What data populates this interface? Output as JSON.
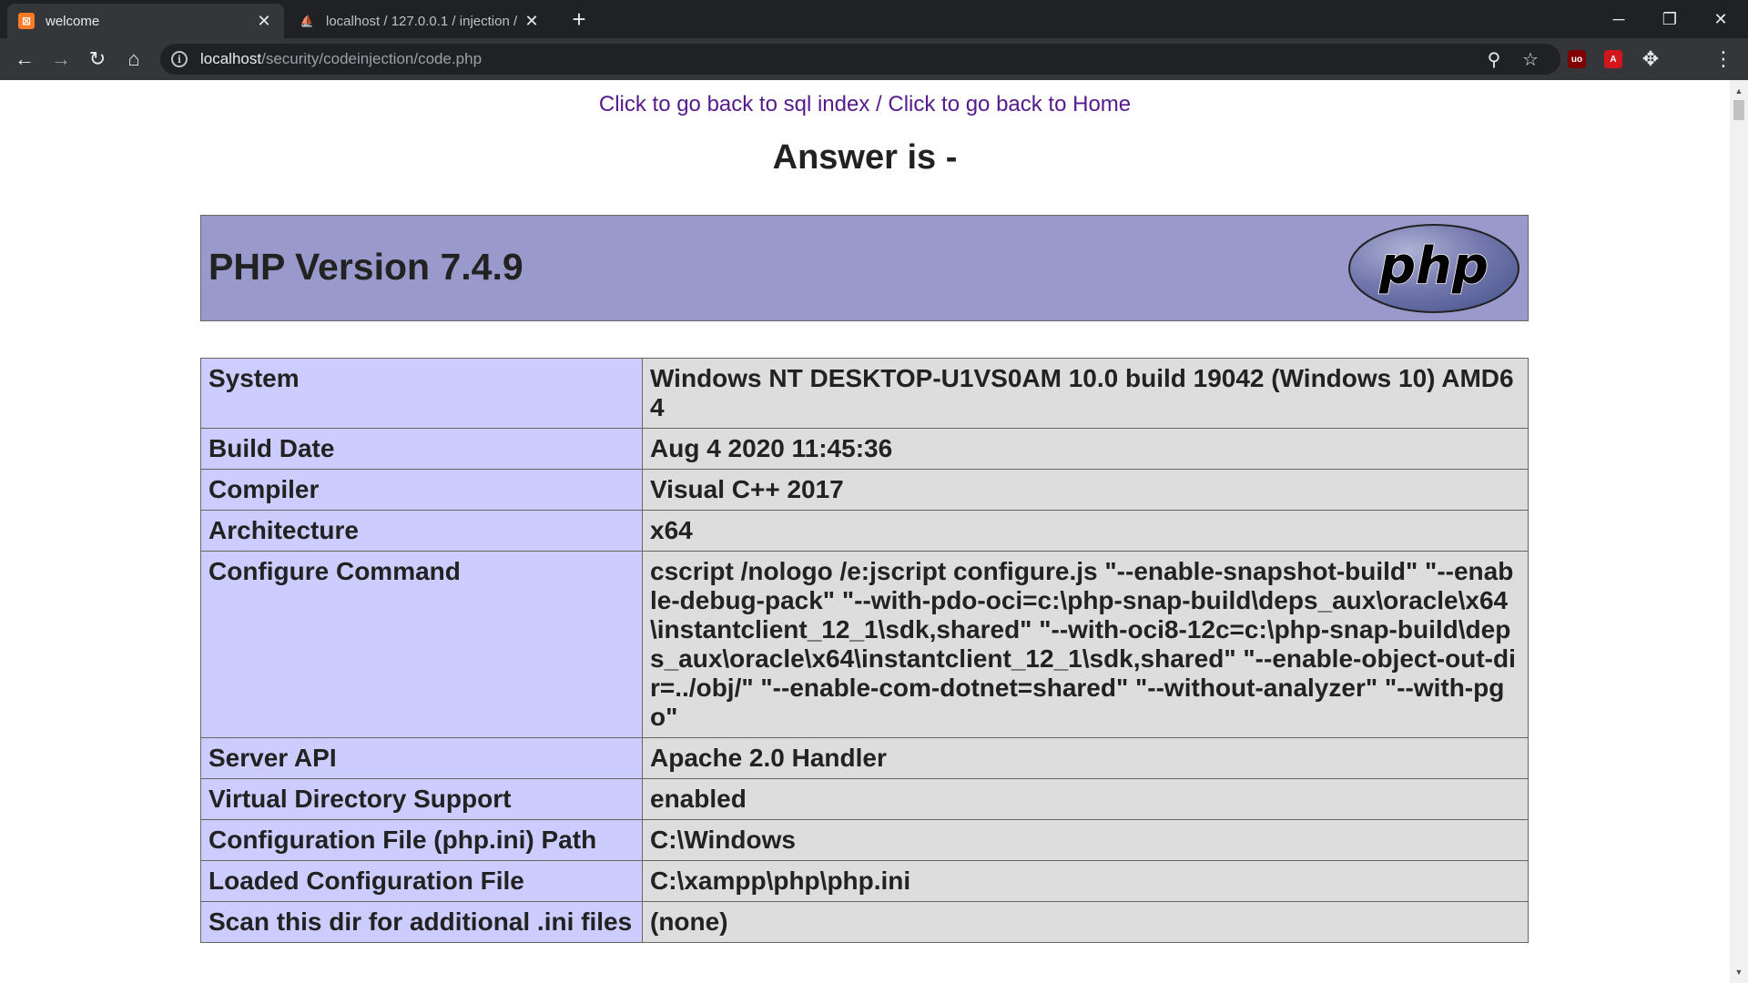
{
  "browser": {
    "tabs": [
      {
        "title": "welcome",
        "favicon": "xampp-icon",
        "active": true
      },
      {
        "title": "localhost / 127.0.0.1 / injection / ",
        "favicon": "phpmyadmin-icon",
        "active": false
      }
    ],
    "url": {
      "host": "localhost",
      "path": "/security/codeinjection/code.php"
    }
  },
  "page": {
    "link_sql": "Click to go back to sql index",
    "link_sep": " / ",
    "link_home": "Click to go back to Home",
    "answer": "Answer is -",
    "php_version": "PHP Version 7.4.9",
    "php_logo_text": "php"
  },
  "info_rows": [
    {
      "key": "System",
      "value": "Windows NT DESKTOP-U1VS0AM 10.0 build 19042 (Windows 10) AMD64"
    },
    {
      "key": "Build Date",
      "value": "Aug 4 2020 11:45:36"
    },
    {
      "key": "Compiler",
      "value": "Visual C++ 2017"
    },
    {
      "key": "Architecture",
      "value": "x64"
    },
    {
      "key": "Configure Command",
      "value": "cscript /nologo /e:jscript configure.js \"--enable-snapshot-build\" \"--enable-debug-pack\" \"--with-pdo-oci=c:\\php-snap-build\\deps_aux\\oracle\\x64\\instantclient_12_1\\sdk,shared\" \"--with-oci8-12c=c:\\php-snap-build\\deps_aux\\oracle\\x64\\instantclient_12_1\\sdk,shared\" \"--enable-object-out-dir=../obj/\" \"--enable-com-dotnet=shared\" \"--without-analyzer\" \"--with-pgo\""
    },
    {
      "key": "Server API",
      "value": "Apache 2.0 Handler"
    },
    {
      "key": "Virtual Directory Support",
      "value": "enabled"
    },
    {
      "key": "Configuration File (php.ini) Path",
      "value": "C:\\Windows"
    },
    {
      "key": "Loaded Configuration File",
      "value": "C:\\xampp\\php\\php.ini"
    },
    {
      "key": "Scan this dir for additional .ini files",
      "value": "(none)"
    }
  ],
  "colors": {
    "header_bg": "#9999cc",
    "key_bg": "#ccccff",
    "value_bg": "#dddddd",
    "link": "#551a8b",
    "chrome_dark": "#202124",
    "chrome_toolbar": "#35363a"
  }
}
